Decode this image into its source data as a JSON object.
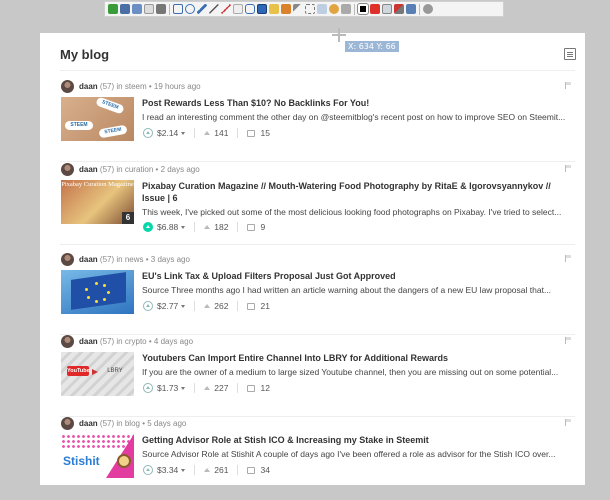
{
  "blog": {
    "title": "My blog"
  },
  "cursor": {
    "readout": "X: 634 Y: 66"
  },
  "posts": [
    {
      "author": "daan",
      "reputation": "(57)",
      "category_prefix": "in",
      "category": "steem",
      "time": "19 hours ago",
      "title": "Post Rewards Less Than $10? No Backlinks For You!",
      "snippet": "I read an interesting comment the other day on @steemitblog's recent post on how to improve SEO on Steemit...",
      "payout": "$2.14",
      "votes": "141",
      "comments": "15",
      "voted": false,
      "thumb_labels": [
        "STEEM",
        "STEEM",
        "STEEM"
      ]
    },
    {
      "author": "daan",
      "reputation": "(57)",
      "category_prefix": "in",
      "category": "curation",
      "time": "2 days ago",
      "title": "Pixabay Curation Magazine // Mouth-Watering Food Photography by RitaE & Igorovsyannykov // Issue | 6",
      "snippet": "This week, I've picked out some of the most delicious looking food photographs on Pixabay. I've tried to select...",
      "payout": "$6.88",
      "votes": "182",
      "comments": "9",
      "voted": true,
      "thumb_caption": "Pixabay Curation Magazine",
      "thumb_issue": "6"
    },
    {
      "author": "daan",
      "reputation": "(57)",
      "category_prefix": "in",
      "category": "news",
      "time": "3 days ago",
      "title": "EU's Link Tax & Upload Filters Proposal Just Got Approved",
      "snippet": "Source Three months ago I had written an article warning about the dangers of a new EU law proposal that...",
      "payout": "$2.77",
      "votes": "262",
      "comments": "21",
      "voted": false
    },
    {
      "author": "daan",
      "reputation": "(57)",
      "category_prefix": "in",
      "category": "crypto",
      "time": "4 days ago",
      "title": "Youtubers Can Import Entire Channel Into LBRY for Additional Rewards",
      "snippet": "If you are the owner of a medium to large sized Youtube channel, then you are missing out on some potential...",
      "payout": "$1.73",
      "votes": "227",
      "comments": "12",
      "voted": false,
      "thumb_left": "YouTube",
      "thumb_right": "LBRY"
    },
    {
      "author": "daan",
      "reputation": "(57)",
      "category_prefix": "in",
      "category": "blog",
      "time": "5 days ago",
      "title": "Getting Advisor Role at Stish ICO & Increasing my Stake in Steemit",
      "snippet": "Source Advisor Role at Stishit A couple of days ago I've been offered a role as advisor for the Stish ICO over...",
      "payout": "$3.34",
      "votes": "261",
      "comments": "34",
      "voted": false,
      "thumb_brand": "Stishit"
    }
  ],
  "colors": {
    "accent": "#06d6a9",
    "page_bg": "#c8c8c8",
    "coord_bg": "#9cb6d6"
  },
  "toolbar": {
    "icons": [
      "check-icon",
      "save-icon",
      "save-as-icon",
      "page-icon",
      "print-icon",
      "rect-icon",
      "ellipse-icon",
      "pencil-icon",
      "line-icon",
      "arrow-icon",
      "text-icon",
      "callout-icon",
      "highlight-icon",
      "stamp-icon",
      "crop-icon",
      "pointer-icon",
      "grid-icon",
      "blur-icon",
      "undo-icon",
      "black-swatch-icon",
      "red-swatch-icon",
      "copy-icon",
      "tools-icon",
      "capture-icon",
      "settings-icon"
    ]
  }
}
